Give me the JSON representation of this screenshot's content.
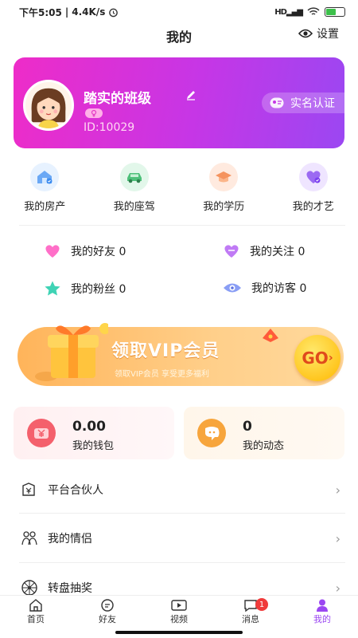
{
  "status_bar": {
    "time": "下午5:05",
    "separator": "|",
    "speed": "4.4K/s",
    "network": "HD"
  },
  "header": {
    "title": "我的",
    "settings_label": "设置",
    "settings_icon": "eye-settings-icon"
  },
  "profile": {
    "nickname": "踏实的班级",
    "user_id": "ID:10029",
    "verify_label": "实名认证",
    "gradient": [
      "#ee2cc8",
      "#9b47f2"
    ]
  },
  "assets": [
    {
      "label": "我的房产",
      "icon": "house-icon",
      "color": "#e7f2ff"
    },
    {
      "label": "我的座驾",
      "icon": "car-icon",
      "color": "#e2f7ea"
    },
    {
      "label": "我的学历",
      "icon": "graduation-cap-icon",
      "color": "#ffeadf"
    },
    {
      "label": "我的才艺",
      "icon": "heart-skill-icon",
      "color": "#efe5ff"
    }
  ],
  "social": [
    {
      "label": "我的好友",
      "count": "0",
      "icon": "pink-heart-icon"
    },
    {
      "label": "我的关注",
      "count": "0",
      "icon": "purple-heart-icon"
    },
    {
      "label": "我的粉丝",
      "count": "0",
      "icon": "star-icon"
    },
    {
      "label": "我的访客",
      "count": "0",
      "icon": "eye-icon"
    }
  ],
  "vip_banner": {
    "title": "领取VIP会员",
    "subtitle": "领取VIP会员  享受更多福利",
    "button": "GO"
  },
  "cards": [
    {
      "value": "0.00",
      "label": "我的钱包",
      "icon": "yen-wallet-icon"
    },
    {
      "value": "0",
      "label": "我的动态",
      "icon": "chat-face-icon"
    }
  ],
  "menu": [
    {
      "label": "平台合伙人",
      "icon": "partner-icon"
    },
    {
      "label": "我的情侣",
      "icon": "couple-icon"
    },
    {
      "label": "转盘抽奖",
      "icon": "wheel-icon"
    }
  ],
  "tabs": [
    {
      "label": "首页",
      "icon": "home-icon"
    },
    {
      "label": "好友",
      "icon": "friends-icon"
    },
    {
      "label": "视频",
      "icon": "video-icon"
    },
    {
      "label": "消息",
      "icon": "message-icon",
      "badge": "1"
    },
    {
      "label": "我的",
      "icon": "profile-icon",
      "active": true
    }
  ],
  "arrow": "›"
}
